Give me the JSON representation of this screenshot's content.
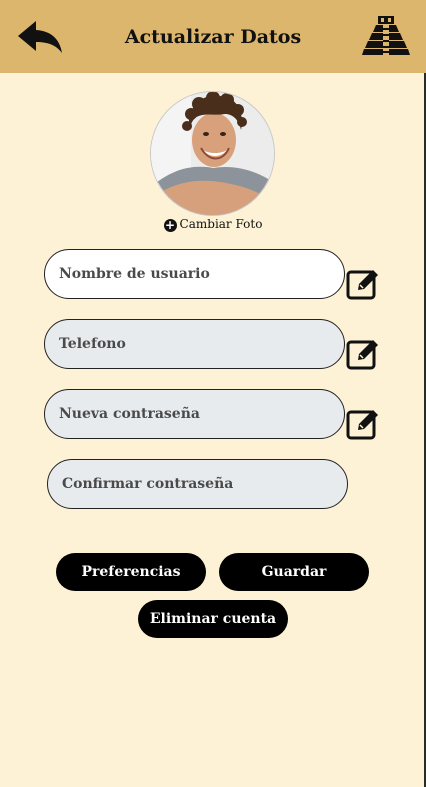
{
  "header": {
    "title": "Actualizar Datos",
    "back_icon": "back-arrow-icon",
    "logo_icon": "pyramid-logo-icon",
    "color": "#ddb66e"
  },
  "profile": {
    "change_photo_label": "Cambiar Foto",
    "change_photo_icon": "plus-circle-icon"
  },
  "form": {
    "username_placeholder": "Nombre de usuario",
    "phone_placeholder": "Telefono",
    "new_password_placeholder": "Nueva contraseña",
    "confirm_password_placeholder": "Confirmar contraseña",
    "edit_icon": "edit-icon"
  },
  "actions": {
    "preferences_label": "Preferencias",
    "save_label": "Guardar",
    "delete_account_label": "Eliminar cuenta"
  },
  "colors": {
    "background": "#fdf1d6",
    "field_background": "#e8ebee",
    "button_background": "#000000"
  }
}
